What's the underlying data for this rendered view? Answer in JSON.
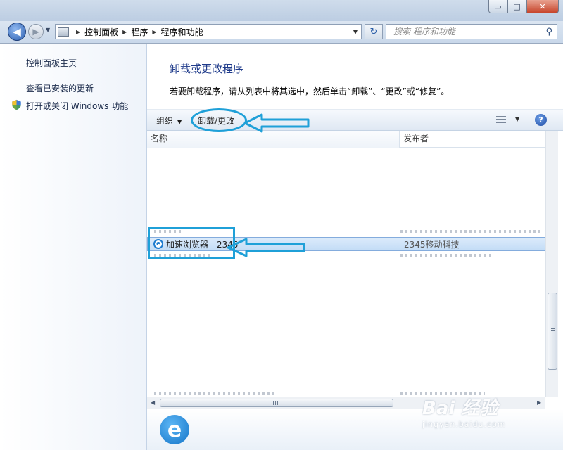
{
  "window": {
    "buttons": {
      "minimize": "▭",
      "maximize": "□",
      "close": "✕"
    }
  },
  "nav": {
    "back_glyph": "◀",
    "forward_glyph": "▶",
    "breadcrumbs": [
      "控制面板",
      "程序",
      "程序和功能"
    ],
    "search_placeholder": "搜索 程序和功能",
    "refresh_glyph": "↻"
  },
  "sidebar": {
    "items": [
      {
        "label": "控制面板主页"
      },
      {
        "label": "查看已安装的更新"
      },
      {
        "label": "打开或关闭 Windows 功能",
        "icon": "shield-icon"
      }
    ]
  },
  "main": {
    "heading": "卸载或更改程序",
    "description": "若要卸载程序，请从列表中将其选中，然后单击“卸载”、“更改”或“修复”。"
  },
  "toolbar": {
    "organize": "组织",
    "uninstall_change": "卸载/更改",
    "help": "?"
  },
  "columns": {
    "name": "名称",
    "publisher": "发布者"
  },
  "programs": [
    {
      "name": "加速浏览器 - 2345",
      "publisher": "2345移动科技",
      "selected": true,
      "icon": "ie-browser-icon"
    }
  ],
  "details": {
    "icon_glyph": "e"
  },
  "watermark": {
    "logo": "Bai 经验",
    "url": "jingyan.baidu.com"
  },
  "colors": {
    "accent": "#1e3a8a",
    "annotation": "#1fa0d8",
    "selection": "#c3dcf6"
  }
}
